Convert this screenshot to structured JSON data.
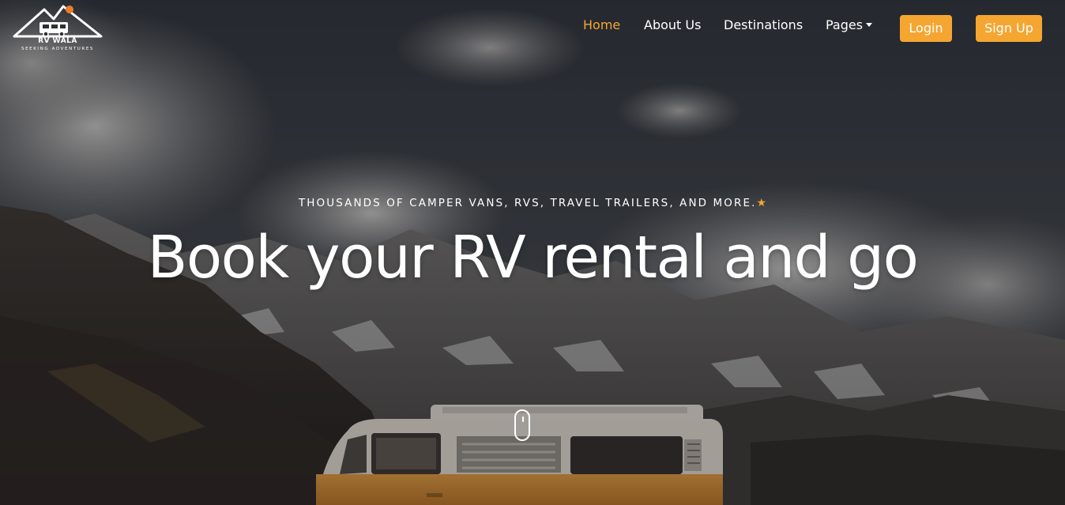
{
  "logo": {
    "title": "RV WALA",
    "subtitle": "SEEKING ADVENTURES"
  },
  "nav": {
    "items": [
      {
        "label": "Home",
        "active": true
      },
      {
        "label": "About Us",
        "active": false
      },
      {
        "label": "Destinations",
        "active": false
      },
      {
        "label": "Pages",
        "active": false,
        "dropdown": true
      }
    ],
    "login_label": "Login",
    "signup_label": "Sign Up"
  },
  "hero": {
    "tagline": "THOUSANDS OF CAMPER VANS, RVS, TRAVEL TRAILERS, AND MORE.",
    "tagline_icon": "star-icon",
    "headline": "Book your RV rental and go",
    "scroll_icon": "mouse-scroll-icon"
  },
  "colors": {
    "accent": "#f5a631",
    "text": "#ffffff"
  }
}
